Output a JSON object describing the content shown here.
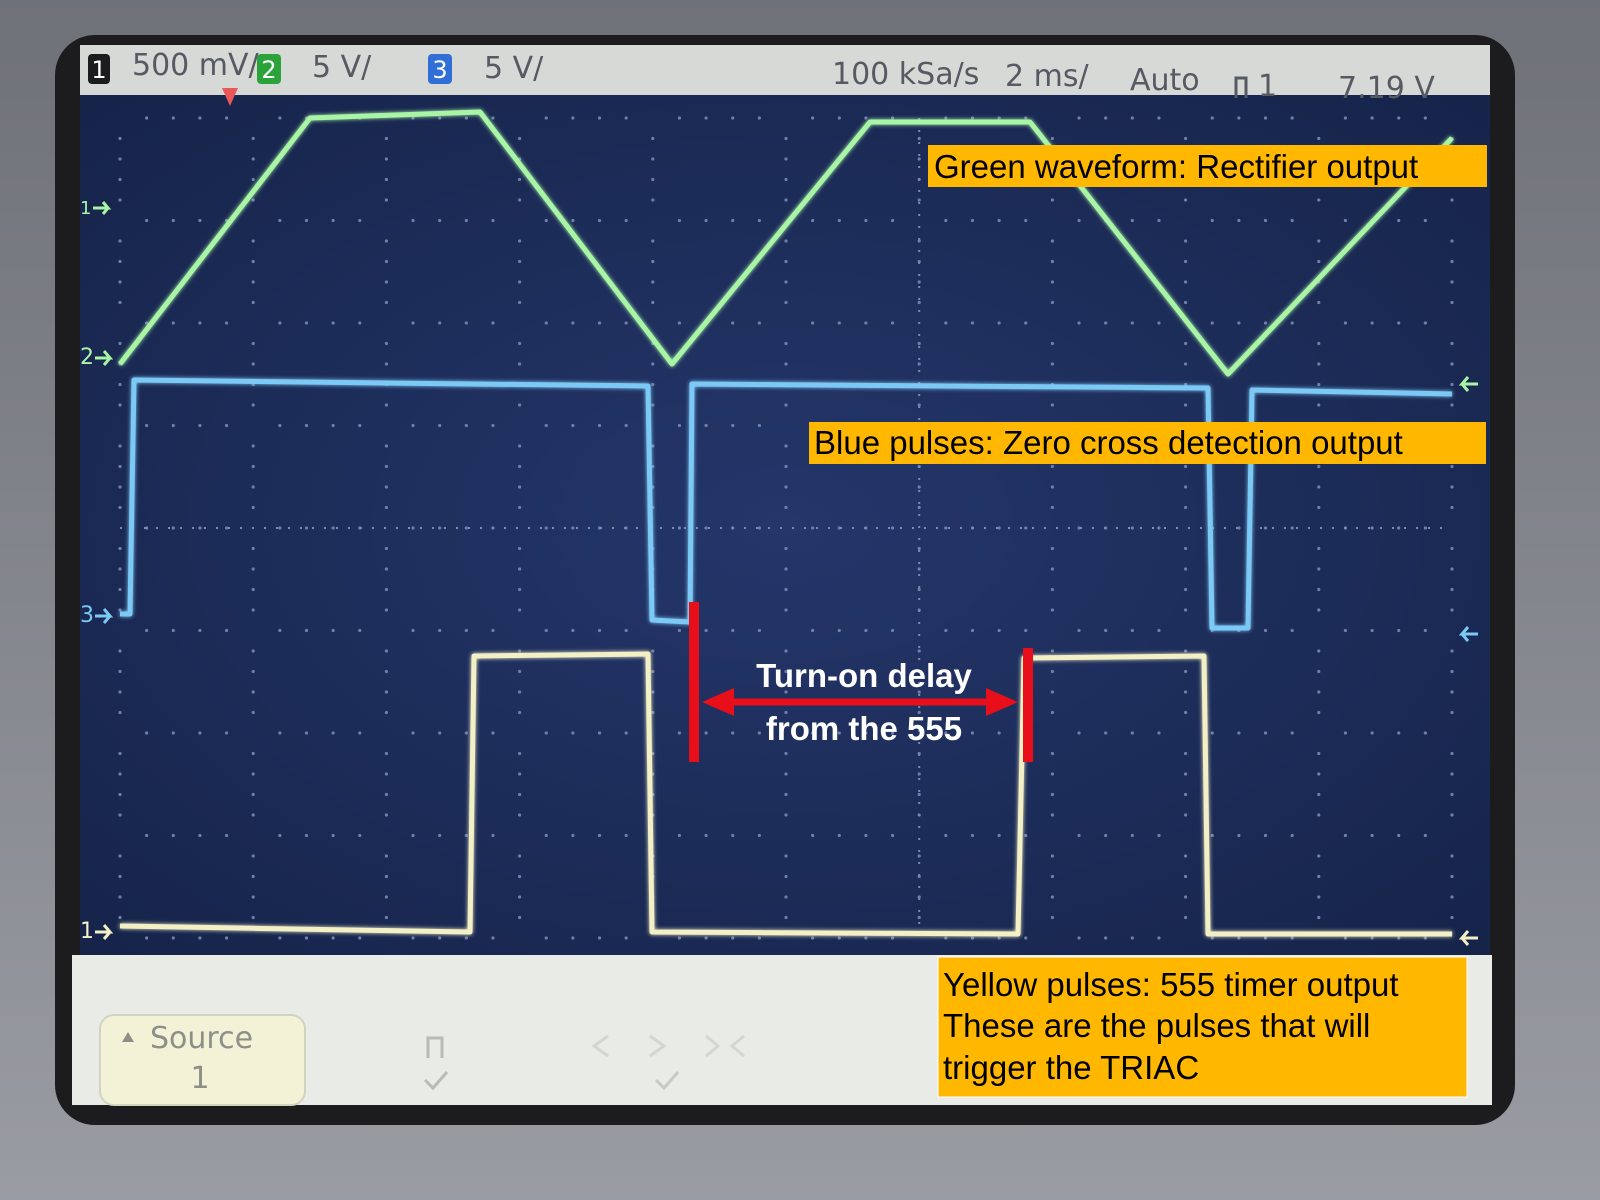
{
  "colors": {
    "screen_background": "#1e2f5c",
    "green_trace": "#a9f5a6",
    "blue_trace": "#7cc9f5",
    "yellow_trace": "#f3f0c6",
    "callout_fill": "#ffb700",
    "delay_marker": "#e80f1a",
    "bezel": "#1c1c1f"
  },
  "header": {
    "ch1_badge": "1",
    "ch1_scale": "500 mV/",
    "ch2_badge": "2",
    "ch2_scale": "5 V/",
    "ch3_badge": "3",
    "ch3_scale": "5 V/",
    "sample_rate": "100 kSa/s",
    "timebase": "2 ms/",
    "trigger_mode": "Auto",
    "trigger_source": "1",
    "trigger_level": "7.19 V"
  },
  "channel_markers": {
    "ch1": "1",
    "ch2": "2",
    "ch3": "3",
    "ch4": "1"
  },
  "softkeys": {
    "source_label": "Source",
    "source_value": "1"
  },
  "annotations": {
    "green_label": "Green waveform: Rectifier output",
    "blue_label": "Blue pulses: Zero cross detection output",
    "yellow_line1": "Yellow pulses: 555 timer output",
    "yellow_line2": "These are the pulses that will",
    "yellow_line3": "trigger the TRIAC",
    "delay_line1": "Turn-on delay",
    "delay_line2": "from the 555"
  },
  "icons": {
    "trigger_edge": "rising-pulse-icon",
    "ground_marker": "arrow-right-icon",
    "trigger_level_marker": "arrow-left-icon",
    "check": "check-icon",
    "delay_arrow": "double-arrow-icon"
  }
}
